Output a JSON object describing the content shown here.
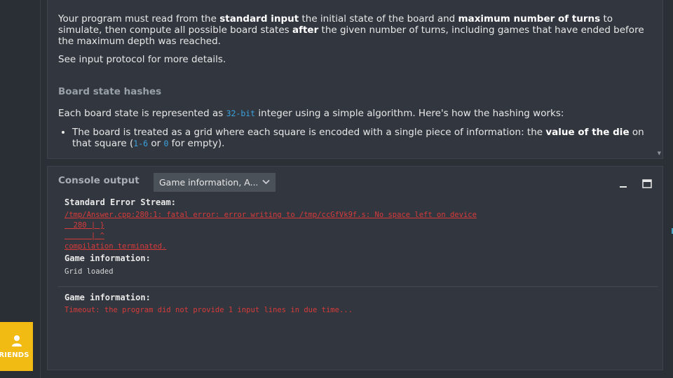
{
  "statement": {
    "top_fragment": "”",
    "para1": [
      {
        "t": "Your program must read from the ",
        "b": false
      },
      {
        "t": "standard input",
        "b": true
      },
      {
        "t": " the initial state of the board and ",
        "b": false
      },
      {
        "t": "maximum number of turns",
        "b": true
      },
      {
        "t": " to simulate, then compute all possible board states ",
        "b": false
      },
      {
        "t": "after",
        "b": true
      },
      {
        "t": " the given number of turns, including games that have ended before the maximum depth was reached.",
        "b": false
      }
    ],
    "para2": "See input protocol for more details.",
    "section_heading": "Board state hashes",
    "para3_before": "Each board state is represented as ",
    "para3_code": "32-bit",
    "para3_after": " integer using a simple algorithm. Here's how the hashing works:",
    "bullet": {
      "before": "The board is treated as a grid where each square is encoded with a single piece of information: the ",
      "bold": "value of the die",
      "middle": " on that square (",
      "code1": "1-6",
      "or": " or ",
      "code2": "0",
      "after": " for empty)."
    }
  },
  "console": {
    "title": "Console output",
    "filter_value": "Game information, A...",
    "block1": {
      "stderr_header": "Standard Error Stream:",
      "error_lines": [
        "/tmp/Answer.cpp:280:1: fatal error: error writing to /tmp/ccGfVk9f.s: No space left on device",
        "  280 | }",
        "      | ^",
        "compilation terminated."
      ],
      "game_header": "Game information:",
      "game_line": "Grid loaded"
    },
    "block2": {
      "game_header": "Game information:",
      "timeout_line": "Timeout: the program did not provide 1 input lines in due time..."
    }
  },
  "friends": {
    "label": "FRIENDS"
  },
  "colors": {
    "accent": "#f2bb13",
    "error": "#d83a3a",
    "code": "#3aa3e0",
    "panel": "#32373f"
  }
}
